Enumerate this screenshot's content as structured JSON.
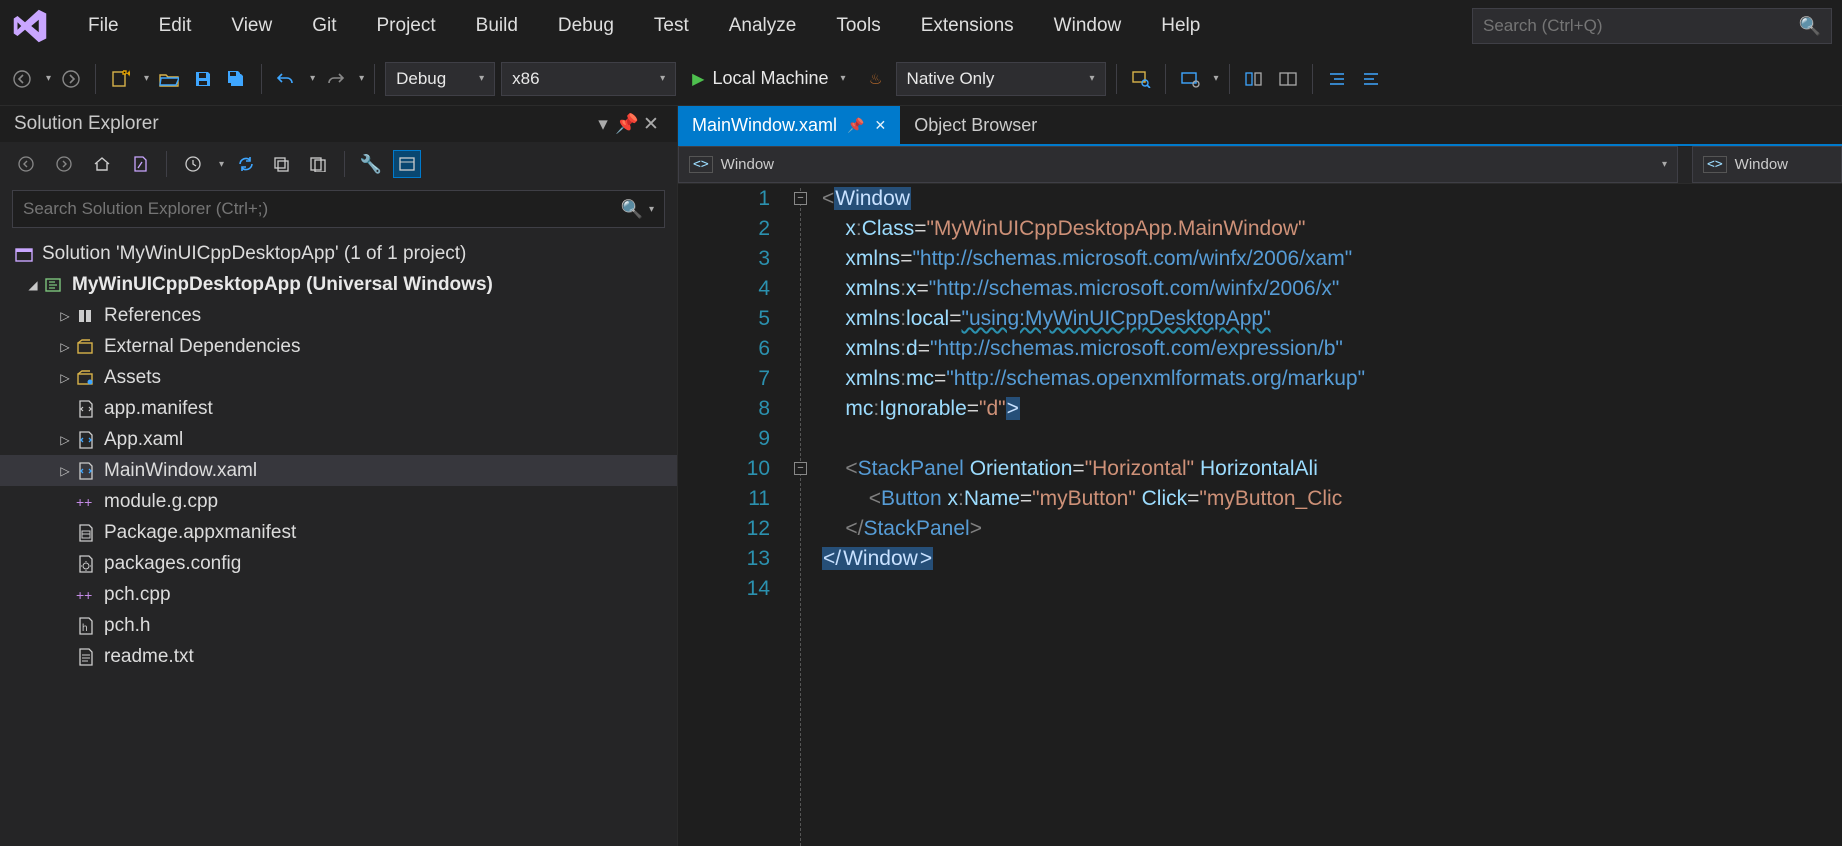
{
  "menu": {
    "items": [
      "File",
      "Edit",
      "View",
      "Git",
      "Project",
      "Build",
      "Debug",
      "Test",
      "Analyze",
      "Tools",
      "Extensions",
      "Window",
      "Help"
    ]
  },
  "search": {
    "placeholder": "Search (Ctrl+Q)"
  },
  "toolbar": {
    "config": "Debug",
    "platform": "x86",
    "run_target": "Local Machine",
    "debug_type": "Native Only"
  },
  "solution_explorer": {
    "title": "Solution Explorer",
    "search_placeholder": "Search Solution Explorer (Ctrl+;)",
    "root": "Solution 'MyWinUICppDesktopApp' (1 of 1 project)",
    "project": "MyWinUICppDesktopApp (Universal Windows)",
    "nodes": [
      {
        "label": "References",
        "ico": "ref",
        "exp": true
      },
      {
        "label": "External Dependencies",
        "ico": "extdep",
        "exp": true
      },
      {
        "label": "Assets",
        "ico": "assets",
        "exp": true
      },
      {
        "label": "app.manifest",
        "ico": "manifest",
        "exp": false
      },
      {
        "label": "App.xaml",
        "ico": "xaml",
        "exp": true
      },
      {
        "label": "MainWindow.xaml",
        "ico": "xaml",
        "exp": true,
        "sel": true
      },
      {
        "label": "module.g.cpp",
        "ico": "cpp",
        "exp": false
      },
      {
        "label": "Package.appxmanifest",
        "ico": "pkg",
        "exp": false
      },
      {
        "label": "packages.config",
        "ico": "cfg",
        "exp": false
      },
      {
        "label": "pch.cpp",
        "ico": "cpp",
        "exp": false
      },
      {
        "label": "pch.h",
        "ico": "h",
        "exp": false
      },
      {
        "label": "readme.txt",
        "ico": "txt",
        "exp": false
      }
    ]
  },
  "editor": {
    "tabs": [
      {
        "label": "MainWindow.xaml",
        "active": true
      },
      {
        "label": "Object Browser",
        "active": false
      }
    ],
    "nav_left": "Window",
    "nav_right": "Window",
    "lines": 14,
    "xaml": {
      "class_attr": "MyWinUICppDesktopApp.MainWindow",
      "xmlns": "http://schemas.microsoft.com/winfx/2006/xam",
      "xmlns_x": "http://schemas.microsoft.com/winfx/2006/x",
      "xmlns_local": "using:MyWinUICppDesktopApp",
      "xmlns_d": "http://schemas.microsoft.com/expression/b",
      "xmlns_mc": "http://schemas.openxmlformats.org/markup",
      "ignorable": "d",
      "sp_orient": "Horizontal",
      "sp_halign_attr": "HorizontalAli",
      "btn_name": "myButton",
      "btn_click": "myButton_Clic"
    }
  }
}
